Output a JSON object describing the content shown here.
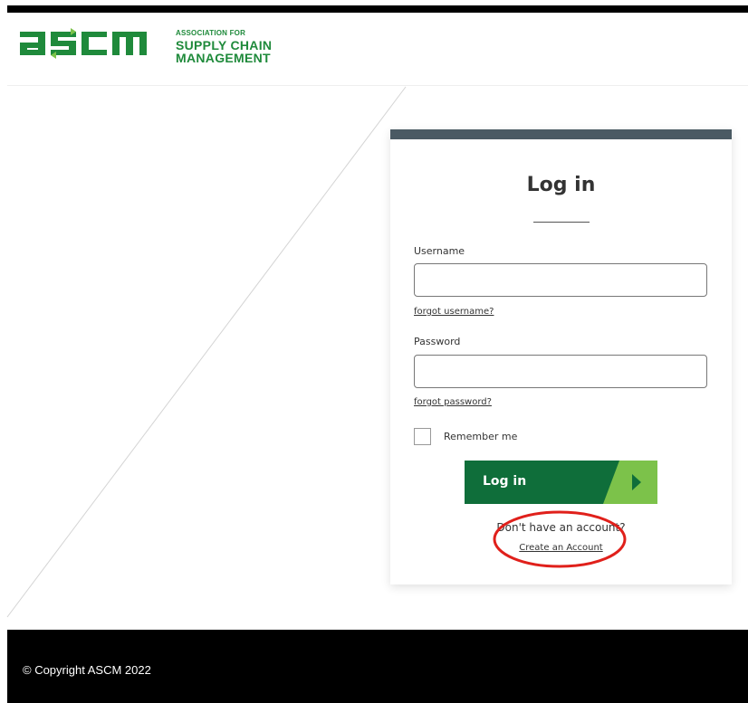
{
  "logo": {
    "wordmark": "ASCM",
    "line1": "ASSOCIATION FOR",
    "line2": "SUPPLY CHAIN",
    "line3": "MANAGEMENT"
  },
  "login": {
    "title": "Log in",
    "username_label": "Username",
    "username_value": "",
    "forgot_username": "forgot username?",
    "password_label": "Password",
    "password_value": "",
    "forgot_password": "forgot password?",
    "remember_label": "Remember me",
    "remember_checked": false,
    "button_label": "Log in",
    "no_account_text": "Don't have an account?",
    "create_account": "Create an Account"
  },
  "footer": {
    "copyright": "© Copyright ASCM 2022"
  },
  "colors": {
    "brand_green": "#1f8a3b",
    "button_green": "#0f6e3a",
    "button_accent": "#7cc24a",
    "card_top_bar": "#4a5a63",
    "annotation_red": "#e0201b"
  }
}
